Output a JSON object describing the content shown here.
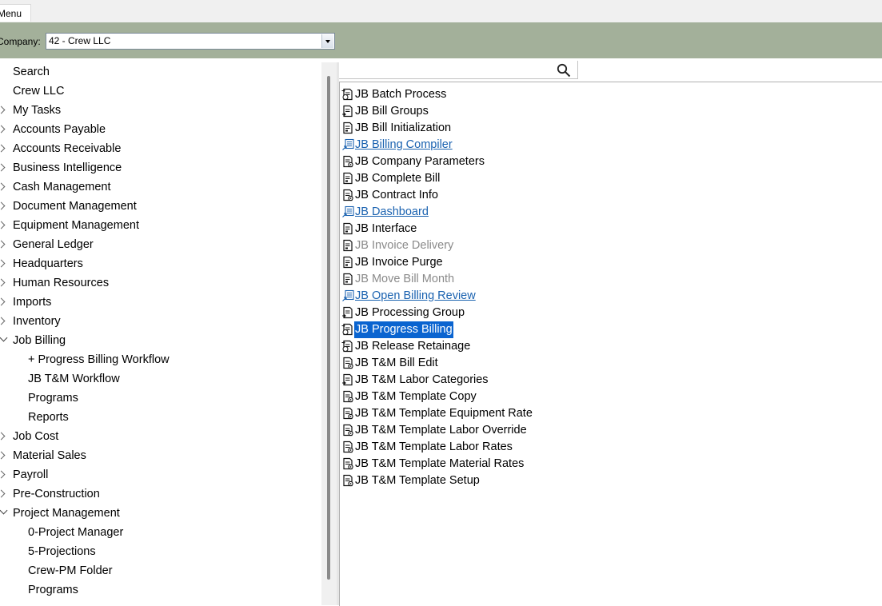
{
  "tabs": {
    "menu_label": "Menu"
  },
  "company": {
    "label": "Company:",
    "value": "42 - Crew LLC"
  },
  "tree": [
    {
      "label": "Search",
      "expander": "none",
      "level": 0
    },
    {
      "label": "Crew LLC",
      "expander": "none",
      "level": 0
    },
    {
      "label": "My Tasks",
      "expander": "collapsed",
      "level": 0
    },
    {
      "label": "Accounts Payable",
      "expander": "collapsed",
      "level": 0
    },
    {
      "label": "Accounts Receivable",
      "expander": "collapsed",
      "level": 0
    },
    {
      "label": "Business Intelligence",
      "expander": "collapsed",
      "level": 0
    },
    {
      "label": "Cash Management",
      "expander": "collapsed",
      "level": 0
    },
    {
      "label": "Document Management",
      "expander": "collapsed",
      "level": 0
    },
    {
      "label": "Equipment Management",
      "expander": "collapsed",
      "level": 0
    },
    {
      "label": "General Ledger",
      "expander": "collapsed",
      "level": 0
    },
    {
      "label": "Headquarters",
      "expander": "collapsed",
      "level": 0
    },
    {
      "label": "Human Resources",
      "expander": "collapsed",
      "level": 0
    },
    {
      "label": "Imports",
      "expander": "collapsed",
      "level": 0
    },
    {
      "label": "Inventory",
      "expander": "collapsed",
      "level": 0
    },
    {
      "label": "Job Billing",
      "expander": "expanded",
      "level": 0
    },
    {
      "label": "+ Progress Billing Workflow",
      "expander": "none",
      "level": 1
    },
    {
      "label": "JB T&M Workflow",
      "expander": "none",
      "level": 1
    },
    {
      "label": "Programs",
      "expander": "none",
      "level": 1
    },
    {
      "label": "Reports",
      "expander": "none",
      "level": 1
    },
    {
      "label": "Job Cost",
      "expander": "collapsed",
      "level": 0
    },
    {
      "label": "Material Sales",
      "expander": "collapsed",
      "level": 0
    },
    {
      "label": "Payroll",
      "expander": "collapsed",
      "level": 0
    },
    {
      "label": "Pre-Construction",
      "expander": "collapsed",
      "level": 0
    },
    {
      "label": "Project Management",
      "expander": "expanded",
      "level": 0
    },
    {
      "label": "0-Project Manager",
      "expander": "none",
      "level": 1
    },
    {
      "label": "5-Projections",
      "expander": "none",
      "level": 1
    },
    {
      "label": "Crew-PM Folder",
      "expander": "none",
      "level": 1
    },
    {
      "label": "Programs",
      "expander": "none",
      "level": 1
    }
  ],
  "search": {
    "icon": "search-icon"
  },
  "programs": [
    {
      "label": "JB Batch Process",
      "icon": "batch-process-icon",
      "state": "normal"
    },
    {
      "label": "JB Bill Groups",
      "icon": "form-edit-icon",
      "state": "normal"
    },
    {
      "label": "JB Bill Initialization",
      "icon": "form-icon",
      "state": "normal"
    },
    {
      "label": "JB Billing Compiler",
      "icon": "report-link-icon",
      "state": "link"
    },
    {
      "label": "JB Company Parameters",
      "icon": "form-settings-icon",
      "state": "normal"
    },
    {
      "label": "JB Complete Bill",
      "icon": "form-icon",
      "state": "normal"
    },
    {
      "label": "JB Contract Info",
      "icon": "form-settings-icon",
      "state": "normal"
    },
    {
      "label": "JB Dashboard",
      "icon": "report-link-icon",
      "state": "link"
    },
    {
      "label": "JB Interface",
      "icon": "form-icon",
      "state": "normal"
    },
    {
      "label": "JB Invoice Delivery",
      "icon": "form-icon",
      "state": "disabled"
    },
    {
      "label": "JB Invoice Purge",
      "icon": "form-icon",
      "state": "normal"
    },
    {
      "label": "JB Move Bill Month",
      "icon": "form-icon",
      "state": "disabled"
    },
    {
      "label": "JB Open Billing Review",
      "icon": "report-link-icon",
      "state": "link"
    },
    {
      "label": "JB Processing Group",
      "icon": "form-edit-icon",
      "state": "normal"
    },
    {
      "label": "JB Progress Billing",
      "icon": "batch-process-icon",
      "state": "selected"
    },
    {
      "label": "JB Release Retainage",
      "icon": "batch-process-icon",
      "state": "normal"
    },
    {
      "label": "JB T&M Bill Edit",
      "icon": "form-settings-icon",
      "state": "normal"
    },
    {
      "label": "JB T&M Labor Categories",
      "icon": "form-edit-icon",
      "state": "normal"
    },
    {
      "label": "JB T&M Template Copy",
      "icon": "form-settings-icon",
      "state": "normal"
    },
    {
      "label": "JB T&M Template Equipment Rate",
      "icon": "form-settings-icon",
      "state": "normal"
    },
    {
      "label": "JB T&M Template Labor Override",
      "icon": "form-settings-icon",
      "state": "normal"
    },
    {
      "label": "JB T&M Template Labor Rates",
      "icon": "form-settings-icon",
      "state": "normal"
    },
    {
      "label": "JB T&M Template Material Rates",
      "icon": "form-settings-icon",
      "state": "normal"
    },
    {
      "label": "JB T&M Template Setup",
      "icon": "form-settings-icon",
      "state": "normal"
    }
  ],
  "colors": {
    "company_bar": "#a3b09a",
    "link": "#1a62b0",
    "disabled": "#8a8a8a",
    "selection": "#0a64d0"
  }
}
